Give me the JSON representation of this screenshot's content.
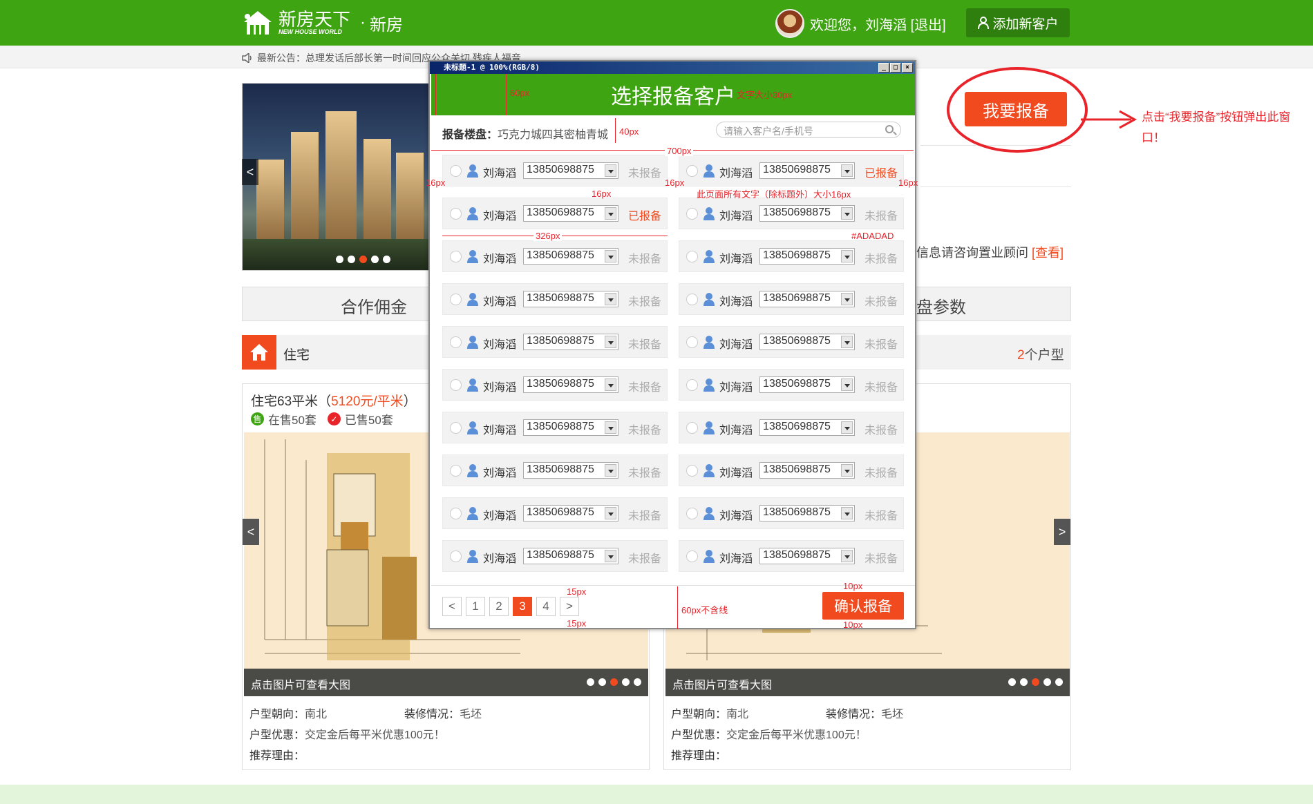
{
  "header": {
    "logo_name": "新房天下",
    "logo_sub": "NEW HOUSE WORLD",
    "separator": "·",
    "section": "新房",
    "welcome": "欢迎您，刘海滔 [退出]",
    "add_client": "添加新客户"
  },
  "notice": {
    "text": "最新公告：总理发话后部长第一时间回应公众关切 残疾人福音"
  },
  "report_button": "我要报备",
  "hint": "点击“我要报备”按钮弹出此窗口！",
  "consult": {
    "text": "信息请咨询置业顾问",
    "link": "[查看]"
  },
  "tabs": {
    "first": "合作佣金",
    "last": "盘参数"
  },
  "type_bar": {
    "label": "住宅",
    "count_num": "2",
    "count_unit": "个户型"
  },
  "cards": [
    {
      "title": "住宅63平米（",
      "price": "5120元/平米",
      "close": "）",
      "on_sale": "在售50套",
      "sold": "已售50套",
      "caption": "点击图片可查看大图",
      "orientation_label": "户型朝向：",
      "orientation": "南北",
      "deco_label": "装修情况：",
      "deco": "毛坯",
      "discount_label": "户型优惠：",
      "discount": "交定金后每平米优惠100元！",
      "reason_label": "推荐理由："
    },
    {
      "caption": "点击图片可查看大图",
      "orientation_label": "户型朝向：",
      "orientation": "南北",
      "deco_label": "装修情况：",
      "deco": "毛坯",
      "discount_label": "户型优惠：",
      "discount": "交定金后每平米优惠100元！",
      "reason_label": "推荐理由："
    }
  ],
  "modal": {
    "window_title": "未标题-1 @ 100%(RGB/8)",
    "title": "选择报备客户",
    "project_label": "报备楼盘：",
    "project": "巧克力城四其密柚青城",
    "search_placeholder": "请输入客户名/手机号",
    "clients": [
      {
        "name": "刘海滔",
        "phone": "13850698875",
        "status": "未报备"
      },
      {
        "name": "刘海滔",
        "phone": "13850698875",
        "status": "已报备"
      },
      {
        "name": "刘海滔",
        "phone": "13850698875",
        "status": "已报备"
      },
      {
        "name": "刘海滔",
        "phone": "13850698875",
        "status": "未报备"
      },
      {
        "name": "刘海滔",
        "phone": "13850698875",
        "status": "未报备"
      },
      {
        "name": "刘海滔",
        "phone": "13850698875",
        "status": "未报备"
      },
      {
        "name": "刘海滔",
        "phone": "13850698875",
        "status": "未报备"
      },
      {
        "name": "刘海滔",
        "phone": "13850698875",
        "status": "未报备"
      },
      {
        "name": "刘海滔",
        "phone": "13850698875",
        "status": "未报备"
      },
      {
        "name": "刘海滔",
        "phone": "13850698875",
        "status": "未报备"
      },
      {
        "name": "刘海滔",
        "phone": "13850698875",
        "status": "未报备"
      },
      {
        "name": "刘海滔",
        "phone": "13850698875",
        "status": "未报备"
      },
      {
        "name": "刘海滔",
        "phone": "13850698875",
        "status": "未报备"
      },
      {
        "name": "刘海滔",
        "phone": "13850698875",
        "status": "未报备"
      },
      {
        "name": "刘海滔",
        "phone": "13850698875",
        "status": "未报备"
      },
      {
        "name": "刘海滔",
        "phone": "13850698875",
        "status": "未报备"
      },
      {
        "name": "刘海滔",
        "phone": "13850698875",
        "status": "未报备"
      },
      {
        "name": "刘海滔",
        "phone": "13850698875",
        "status": "未报备"
      },
      {
        "name": "刘海滔",
        "phone": "13850698875",
        "status": "未报备"
      },
      {
        "name": "刘海滔",
        "phone": "13850698875",
        "status": "未报备"
      }
    ],
    "pager": [
      "<",
      "1",
      "2",
      "3",
      "4",
      ">"
    ],
    "current_page": "3",
    "confirm": "确认报备"
  },
  "annotations": {
    "h60": "60px",
    "font30": "文字大小30px",
    "h40": "40px",
    "w700": "700px",
    "p16a": "16px",
    "p16b": "16px",
    "p16c": "16px",
    "g16": "16px",
    "allfont": "此页面所有文字（除标题外）大小16px",
    "w326": "326px",
    "color": "#ADADAD",
    "p15a": "15px",
    "p15b": "15px",
    "f60": "60px不含线",
    "p10a": "10px",
    "p10b": "10px"
  },
  "colors": {
    "green": "#3ea412",
    "orange": "#f04a1e",
    "gray_text": "#adadad",
    "annotation_red": "#e8232a"
  }
}
